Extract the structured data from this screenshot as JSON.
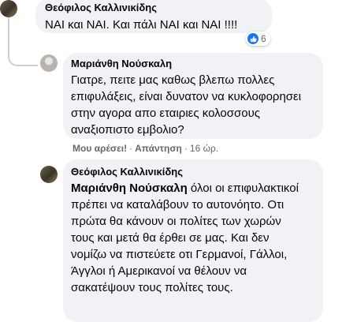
{
  "comments": [
    {
      "author": "Θεόφιλος Καλλινικίδης",
      "text": "ΝΑΙ και ΝΑΙ. Και πάλι ΝΑΙ και ΝΑΙ !!!!",
      "reaction_count": "6"
    },
    {
      "author": "Μαριάνθη Νούσκαλη",
      "text": "Γιατρε, πειτε μας καθως βλεπω πολλες επιφυλάξεις, είναι δυνατον να κυκλοφορησει στην αγορα απο εταιριες κολοσσους αναξιοπιστο εμβολιο?"
    },
    {
      "author": "Θεόφιλος Καλλινικίδης",
      "mention": "Μαριάνθη Νούσκαλη",
      "text": "όλοι οι επιφυλακτικοί πρέπει να καταλάβουν το αυτονόητο. Οτι πρώτα θα κάνουν οι πολίτες των χωρών τους και μετά θα έρθει σε μας. Και δεν νομίζω να πιστεύετε οτι Γερμανοί, Γάλλοι, Άγγλοι ή Αμερικανοί να θέλουν να σακατέψουν τους πολίτες τους."
    }
  ],
  "actions": {
    "like": "Μου αρέσει!",
    "reply": "Απάντηση",
    "separator": "·",
    "time": "16 ώρ."
  },
  "colors": {
    "bubble": "#f0f2f5",
    "like_blue": "#1877f2",
    "meta_gray": "#65676b"
  }
}
